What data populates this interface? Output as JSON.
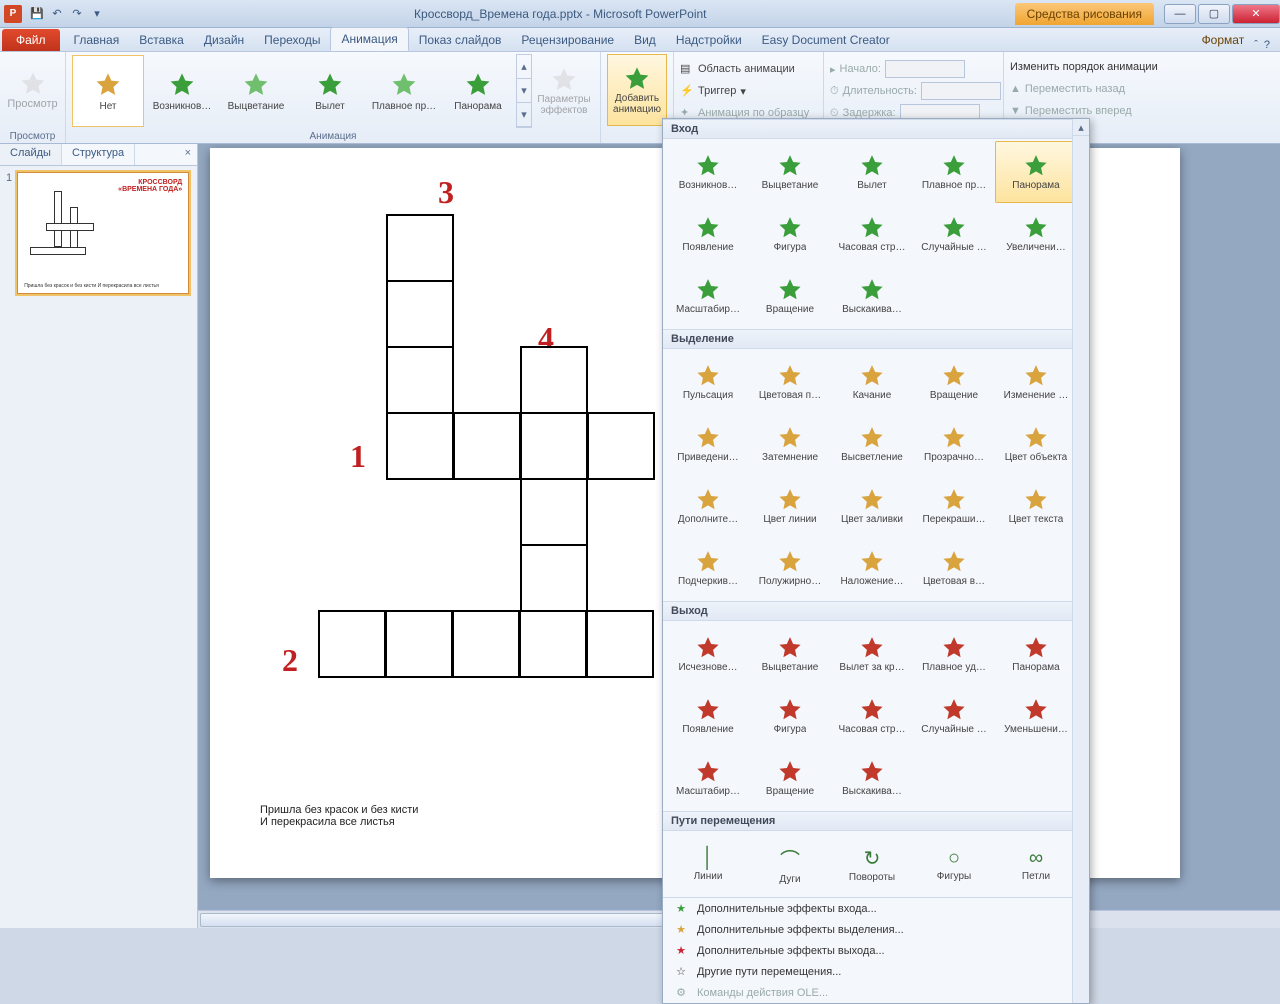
{
  "title": "Кроссворд_Времена года.pptx - Microsoft PowerPoint",
  "contextual_tab": "Средства рисования",
  "file_tab": "Файл",
  "tabs": [
    "Главная",
    "Вставка",
    "Дизайн",
    "Переходы",
    "Анимация",
    "Показ слайдов",
    "Рецензирование",
    "Вид",
    "Надстройки",
    "Easy Document Creator"
  ],
  "context_format": "Формат",
  "ribbon": {
    "preview_btn": "Просмотр",
    "preview_group": "Просмотр",
    "gallery": [
      "Нет",
      "Возникнов…",
      "Выцветание",
      "Вылет",
      "Плавное пр…",
      "Панорама"
    ],
    "params": "Параметры эффектов",
    "anim_group": "Анимация",
    "add": "Добавить анимацию",
    "adv1": "Область анимации",
    "adv2": "Триггер",
    "adv3": "Анимация по образцу",
    "timing": {
      "start": "Начало:",
      "duration": "Длительность:",
      "delay": "Задержка:"
    },
    "reorder": {
      "title": "Изменить порядок анимации",
      "back": "Переместить назад",
      "fwd": "Переместить вперед"
    }
  },
  "pane": {
    "slides": "Слайды",
    "outline": "Структура",
    "num": "1",
    "thumb_title1": "КРОССВОРД",
    "thumb_title2": "«ВРЕМЕНА ГОДА»",
    "thumb_text": "Пришла без красок и без кисти И перекрасила все листья"
  },
  "slide": {
    "nums": {
      "n1": "1",
      "n2": "2",
      "n3": "3",
      "n4": "4"
    },
    "riddle1": "Пришла без красок и без кисти",
    "riddle2": "И перекрасила все листья"
  },
  "dropdown": {
    "sections": {
      "entrance": "Вход",
      "emphasis": "Выделение",
      "exit": "Выход",
      "motion": "Пути перемещения"
    },
    "entrance": [
      "Возникнов…",
      "Выцветание",
      "Вылет",
      "Плавное пр…",
      "Панорама",
      "Появление",
      "Фигура",
      "Часовая стр…",
      "Случайные …",
      "Увеличени…",
      "Масштабир…",
      "Вращение",
      "Выскакива…"
    ],
    "emphasis": [
      "Пульсация",
      "Цветовая п…",
      "Качание",
      "Вращение",
      "Изменение …",
      "Приведени…",
      "Затемнение",
      "Высветление",
      "Прозрачно…",
      "Цвет объекта",
      "Дополните…",
      "Цвет линии",
      "Цвет заливки",
      "Перекраши…",
      "Цвет текста",
      "Подчеркив…",
      "Полужирно…",
      "Наложение…",
      "Цветовая в…"
    ],
    "exit": [
      "Исчезнове…",
      "Выцветание",
      "Вылет за кр…",
      "Плавное уд…",
      "Панорама",
      "Появление",
      "Фигура",
      "Часовая стр…",
      "Случайные …",
      "Уменьшени…",
      "Масштабир…",
      "Вращение",
      "Выскакива…"
    ],
    "motion": [
      "Линии",
      "Дуги",
      "Повороты",
      "Фигуры",
      "Петли"
    ],
    "menu": [
      "Дополнительные эффекты входа...",
      "Дополнительные эффекты выделения...",
      "Дополнительные эффекты выхода...",
      "Другие пути перемещения...",
      "Команды действия OLE..."
    ]
  }
}
